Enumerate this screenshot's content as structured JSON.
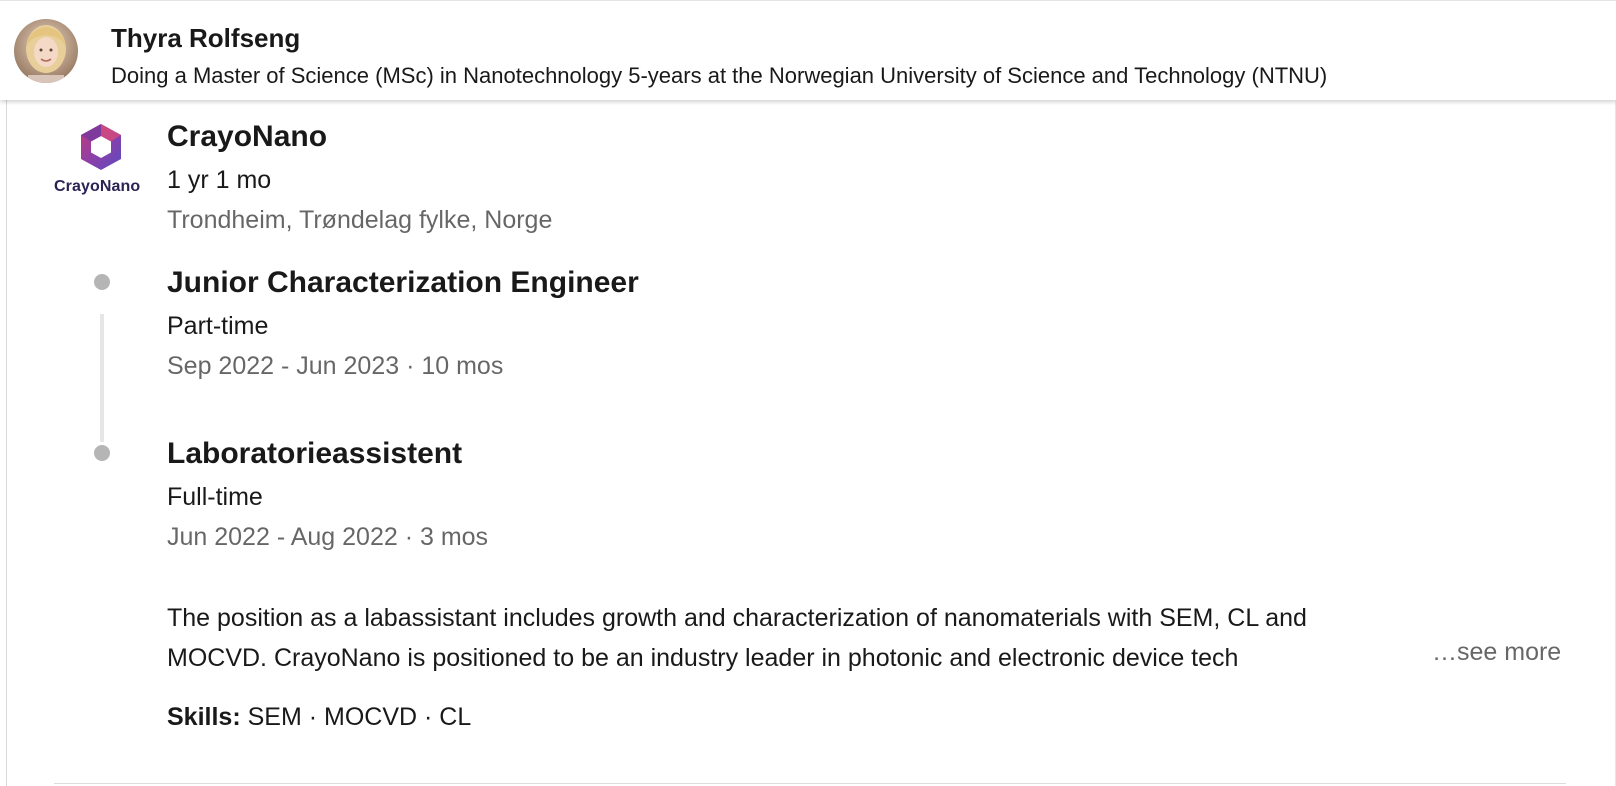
{
  "header": {
    "name": "Thyra Rolfseng",
    "headline": "Doing a Master of Science (MSc) in Nanotechnology 5-years at the Norwegian University of Science and Technology (NTNU)"
  },
  "company": {
    "logo_text": "CrayoNano",
    "name": "CrayoNano",
    "duration": "1 yr 1 mo",
    "location": "Trondheim, Trøndelag fylke, Norge",
    "brand_colors": [
      "#c23a78",
      "#8d3fa8",
      "#5b4bbf"
    ]
  },
  "positions": [
    {
      "title": "Junior Characterization Engineer",
      "employment_type": "Part-time",
      "dates": "Sep 2022 - Jun 2023 · 10 mos"
    },
    {
      "title": "Laboratorieassistent",
      "employment_type": "Full-time",
      "dates": "Jun 2022 - Aug 2022 · 3 mos",
      "description_line1": "The position as a labassistant includes growth and characterization of nanomaterials with SEM, CL and",
      "description_line2": "MOCVD. CrayoNano is positioned to be an industry leader in photonic and electronic device tech",
      "see_more": "…see more",
      "skills_label": "Skills:",
      "skills": "SEM · MOCVD · CL"
    }
  ]
}
